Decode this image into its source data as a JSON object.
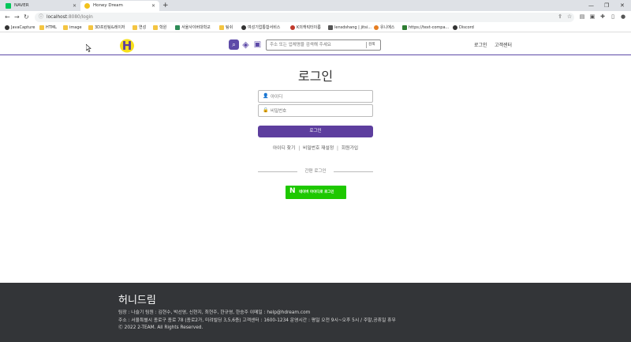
{
  "browser": {
    "tabs": [
      {
        "title": "NAVER",
        "active": false,
        "favicon_color": "#03c75a"
      },
      {
        "title": "Honey Dream",
        "active": true,
        "favicon_color": "#f2c21b"
      }
    ],
    "new_tab": "+",
    "window_controls": {
      "minimize": "—",
      "restore": "❐",
      "close": "✕"
    },
    "url_host": "localhost",
    "url_rest": ":8080/login",
    "nav": {
      "back": "←",
      "forward": "→",
      "reload": "↻"
    },
    "bookmarks": [
      {
        "label": "JavaCapture",
        "color": "#333333"
      },
      {
        "label": "HTML",
        "color": "#f4c542"
      },
      {
        "label": "image",
        "color": "#f4c542"
      },
      {
        "label": "3D프린팅&레이저",
        "color": "#f4c542"
      },
      {
        "label": "연성",
        "color": "#f4c542"
      },
      {
        "label": "학원",
        "color": "#f4c542"
      },
      {
        "label": "서울사이버대학교",
        "color": "#2e8b57"
      },
      {
        "label": "팀쉬",
        "color": "#f4c542"
      },
      {
        "label": "여성기업통합서비스",
        "color": "#333333"
      },
      {
        "label": "K의캐릭터이름",
        "color": "#c0392b"
      },
      {
        "label": "lensdshang | jitsi...",
        "color": "#555555"
      },
      {
        "label": "유니에스",
        "color": "#e67e22"
      },
      {
        "label": "https://text-compa...",
        "color": "#2e7d32"
      },
      {
        "label": "Discord",
        "color": "#333333"
      }
    ]
  },
  "header": {
    "logo_letter": "H",
    "search_placeholder": "주소 또는 업체명을 검색해 주세요",
    "search_button": "검색",
    "login_link": "로그인",
    "support_link": "고객센터"
  },
  "login": {
    "title": "로그인",
    "id_placeholder": "아이디",
    "password_placeholder": "비밀번호",
    "submit": "로그인",
    "find_id": "아이디 찾기",
    "reset_password": "비밀번호 재설정",
    "signup": "회원가입",
    "link_separator": "|",
    "easy_login": "간편 로그인",
    "naver_letter": "N",
    "naver_login": "네이버 아이디로 로그인"
  },
  "footer": {
    "title": "허니드림",
    "line1": "팀장 : 나슬기     팀원 : 김현수, 박선영, 신현지, 최현주, 한규영, 한승주     이메일 : help@hdream.com",
    "line2": "주소 : 서울특별시 종로구 종로 78 (종로2가, 미려빌딩 3,5,6층)     고객센터 : 1600-1234     운영시간 : 평일 오전 9시~오후 5시 / 주말,공휴일 휴무",
    "line3": "Ⓒ 2022 2-TEAM. All Rights Reserved."
  }
}
